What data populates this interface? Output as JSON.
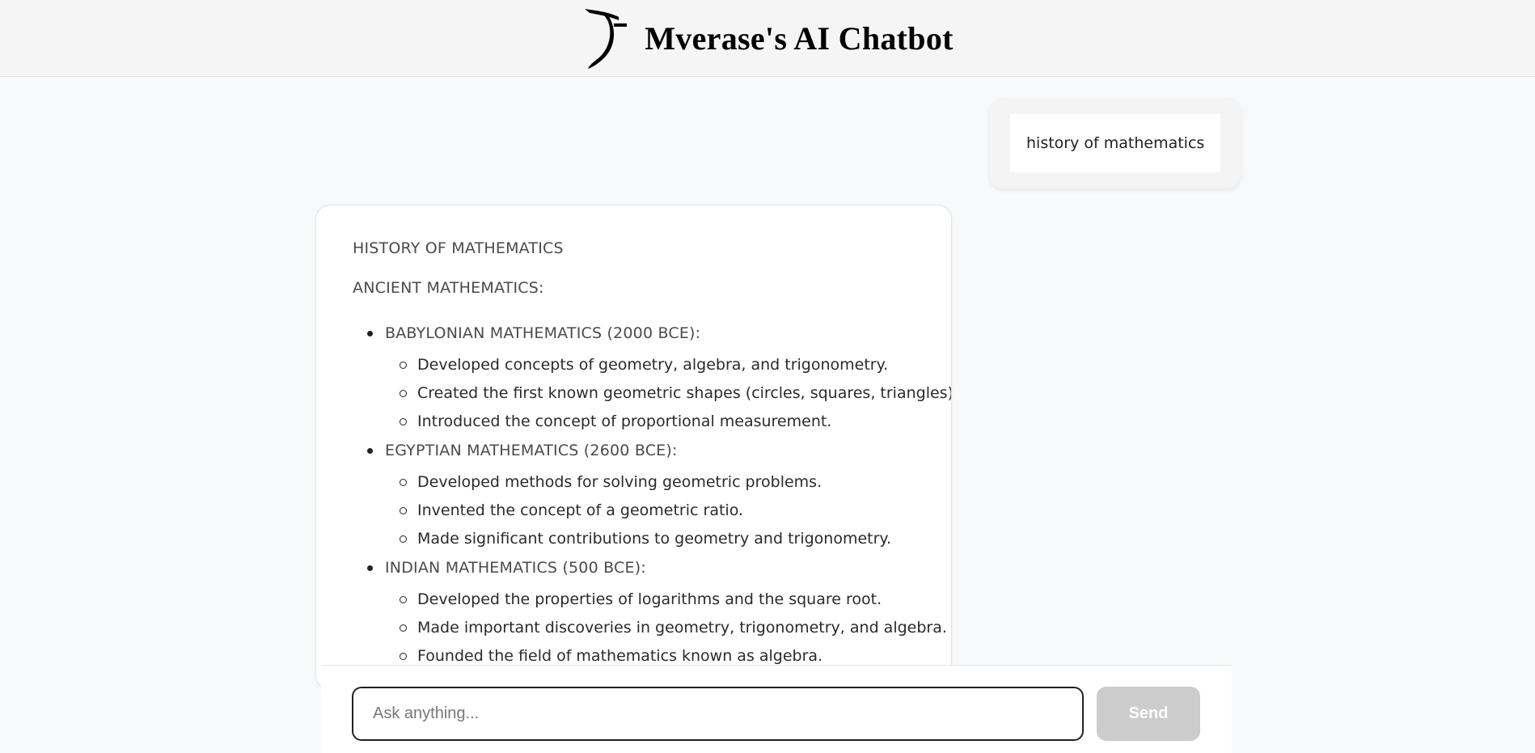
{
  "header": {
    "title": "Mverase's AI Chatbot",
    "logo_icon": "brand-logo-icon"
  },
  "chat": {
    "user_message": "history of mathematics",
    "bot_response": {
      "heading": "HISTORY OF MATHEMATICS",
      "subheading": "ANCIENT MATHEMATICS:",
      "sections": [
        {
          "title": "BABYLONIAN MATHEMATICS (2000 BCE):",
          "points": [
            "Developed concepts of geometry, algebra, and trigonometry.",
            "Created the first known geometric shapes (circles, squares, triangles).",
            "Introduced the concept of proportional measurement."
          ]
        },
        {
          "title": "EGYPTIAN MATHEMATICS (2600 BCE):",
          "points": [
            "Developed methods for solving geometric problems.",
            "Invented the concept of a geometric ratio.",
            "Made significant contributions to geometry and trigonometry."
          ]
        },
        {
          "title": "INDIAN MATHEMATICS (500 BCE):",
          "points": [
            "Developed the properties of logarithms and the square root.",
            "Made important discoveries in geometry, trigonometry, and algebra.",
            "Founded the field of mathematics known as algebra."
          ]
        }
      ]
    }
  },
  "input": {
    "placeholder": "Ask anything...",
    "value": "",
    "send_label": "Send"
  },
  "colors": {
    "send_disabled_bg": "#cccccc",
    "page_bg": "#f8f9fa",
    "header_bg": "#f5f5f5"
  }
}
